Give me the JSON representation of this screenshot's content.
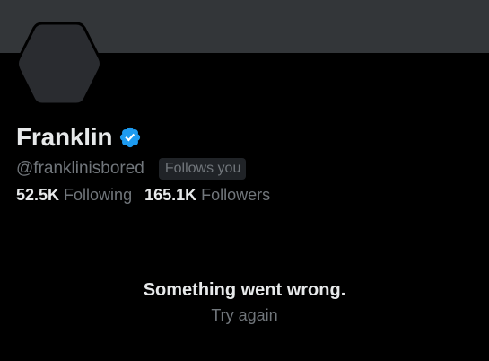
{
  "profile": {
    "display_name": "Franklin",
    "verified": true,
    "handle": "@franklinisbored",
    "follows_you_label": "Follows you",
    "following_count": "52.5K",
    "following_label": "Following",
    "followers_count": "165.1K",
    "followers_label": "Followers"
  },
  "error": {
    "message": "Something went wrong.",
    "retry_label": "Try again"
  },
  "icons": {
    "avatar": "hexagon-avatar-placeholder",
    "verified": "verified-check-badge-icon"
  },
  "colors": {
    "background": "#000000",
    "banner": "#333639",
    "avatar_fill": "#2a2c30",
    "primary_text": "#e7e9ea",
    "secondary_text": "#71767b",
    "badge_background": "#202327",
    "verified_blue": "#1d9bf0"
  }
}
